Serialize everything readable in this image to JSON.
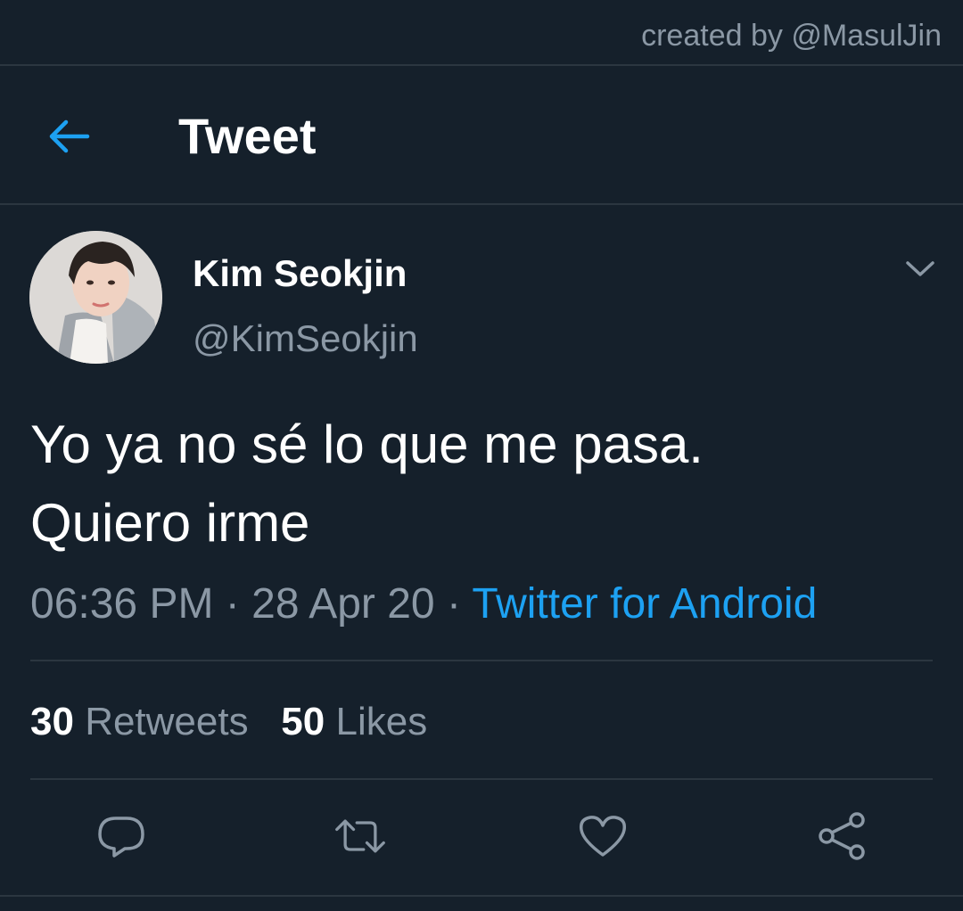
{
  "watermark": "created by @MasulJin",
  "header": {
    "title": "Tweet",
    "back_icon": "arrow-left-icon"
  },
  "tweet": {
    "author": {
      "name": "Kim Seokjin",
      "handle": "@KimSeokjin"
    },
    "text": "Yo ya no sé lo que me pasa.\nQuiero irme",
    "time": "06:36 PM",
    "date": "28 Apr 20",
    "separator": "·",
    "source": "Twitter for Android",
    "retweets_count": "30",
    "retweets_label": "Retweets",
    "likes_count": "50",
    "likes_label": "Likes"
  },
  "actions": [
    {
      "name": "reply",
      "icon": "reply-icon"
    },
    {
      "name": "retweet",
      "icon": "retweet-icon"
    },
    {
      "name": "like",
      "icon": "heart-icon"
    },
    {
      "name": "share",
      "icon": "share-icon"
    }
  ],
  "colors": {
    "background": "#15202b",
    "accent": "#1da1f2",
    "secondary_text": "#8b98a5",
    "divider": "#2b3640"
  }
}
